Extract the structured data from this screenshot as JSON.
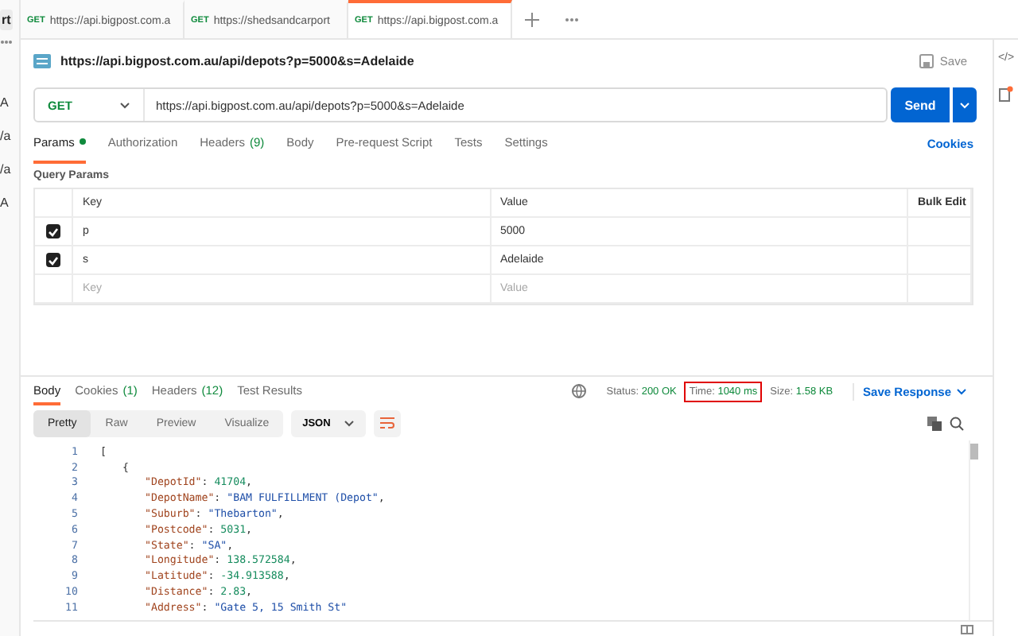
{
  "sidebar": {
    "items": [
      {
        "label": "rt",
        "kind": "button"
      },
      {
        "label": "A",
        "kind": "text"
      },
      {
        "label": "/a",
        "kind": "text"
      },
      {
        "label": "/a",
        "kind": "text"
      },
      {
        "label": "A",
        "kind": "text"
      }
    ]
  },
  "tabs": [
    {
      "method": "GET",
      "url": "https://api.bigpost.com.a",
      "selected": false
    },
    {
      "method": "GET",
      "url": "https://shedsandcarport",
      "selected": false
    },
    {
      "method": "GET",
      "url": "https://api.bigpost.com.a",
      "selected": true
    }
  ],
  "request": {
    "title": "https://api.bigpost.com.au/api/depots?p=5000&s=Adelaide",
    "save": "Save",
    "method": "GET",
    "url": "https://api.bigpost.com.au/api/depots?p=5000&s=Adelaide",
    "send": "Send"
  },
  "request_tabs": [
    {
      "label": "Params",
      "dot": true,
      "selected": true
    },
    {
      "label": "Authorization",
      "dot": false,
      "selected": false
    },
    {
      "label": "Headers",
      "count": "(9)",
      "dot": false,
      "selected": false
    },
    {
      "label": "Body",
      "dot": false,
      "selected": false
    },
    {
      "label": "Pre-request Script",
      "dot": false,
      "selected": false
    },
    {
      "label": "Tests",
      "dot": false,
      "selected": false
    },
    {
      "label": "Settings",
      "dot": false,
      "selected": false
    }
  ],
  "cookies": "Cookies",
  "query_params": {
    "title": "Query Params",
    "columns": [
      "Key",
      "Value"
    ],
    "bulk_edit": "Bulk Edit",
    "rows": [
      {
        "key": "p",
        "value": "5000",
        "checked": true
      },
      {
        "key": "s",
        "value": "Adelaide",
        "checked": true
      }
    ],
    "new_row": {
      "key": {
        "placeholder": "Key"
      },
      "value": {
        "placeholder": "Value"
      }
    }
  },
  "response": {
    "tabs": [
      {
        "label": "Body",
        "selected": true
      },
      {
        "label": "Cookies",
        "count": "(1)",
        "selected": false
      },
      {
        "label": "Headers",
        "count": "(12)",
        "selected": false
      },
      {
        "label": "Test Results",
        "selected": false
      }
    ],
    "stats": [
      {
        "label": "Status:",
        "value": "200 OK",
        "highlighted": false
      },
      {
        "label": "Time:",
        "value": "1040 ms",
        "highlighted": true
      },
      {
        "label": "Size:",
        "value": "1.58 KB",
        "highlighted": false
      }
    ],
    "save_response": "Save Response",
    "views": [
      {
        "label": "Pretty",
        "selected": true
      },
      {
        "label": "Raw",
        "selected": false
      },
      {
        "label": "Preview",
        "selected": false
      },
      {
        "label": "Visualize",
        "selected": false
      }
    ],
    "format": "JSON",
    "code": [
      {
        "number": "1",
        "tokens": [
          {
            "kind": "punct",
            "text": "["
          }
        ],
        "children": [
          {
            "number": "2",
            "tokens": [
              {
                "kind": "punct",
                "text": "{"
              }
            ],
            "children": [
              {
                "number": "3",
                "tokens": [
                  {
                    "kind": "key",
                    "text": "\"DepotId\""
                  },
                  {
                    "kind": "punct",
                    "text": ": "
                  },
                  {
                    "kind": "number",
                    "text": "41704"
                  },
                  {
                    "kind": "punct",
                    "text": ","
                  }
                ]
              },
              {
                "number": "4",
                "tokens": [
                  {
                    "kind": "key",
                    "text": "\"DepotName\""
                  },
                  {
                    "kind": "punct",
                    "text": ": "
                  },
                  {
                    "kind": "string",
                    "text": "\"BAM FULFILLMENT (Depot\""
                  },
                  {
                    "kind": "punct",
                    "text": ","
                  }
                ]
              },
              {
                "number": "5",
                "tokens": [
                  {
                    "kind": "key",
                    "text": "\"Suburb\""
                  },
                  {
                    "kind": "punct",
                    "text": ": "
                  },
                  {
                    "kind": "string",
                    "text": "\"Thebarton\""
                  },
                  {
                    "kind": "punct",
                    "text": ","
                  }
                ]
              },
              {
                "number": "6",
                "tokens": [
                  {
                    "kind": "key",
                    "text": "\"Postcode\""
                  },
                  {
                    "kind": "punct",
                    "text": ": "
                  },
                  {
                    "kind": "number",
                    "text": "5031"
                  },
                  {
                    "kind": "punct",
                    "text": ","
                  }
                ]
              },
              {
                "number": "7",
                "tokens": [
                  {
                    "kind": "key",
                    "text": "\"State\""
                  },
                  {
                    "kind": "punct",
                    "text": ": "
                  },
                  {
                    "kind": "string",
                    "text": "\"SA\""
                  },
                  {
                    "kind": "punct",
                    "text": ","
                  }
                ]
              },
              {
                "number": "8",
                "tokens": [
                  {
                    "kind": "key",
                    "text": "\"Longitude\""
                  },
                  {
                    "kind": "punct",
                    "text": ": "
                  },
                  {
                    "kind": "number",
                    "text": "138.572584"
                  },
                  {
                    "kind": "punct",
                    "text": ","
                  }
                ]
              },
              {
                "number": "9",
                "tokens": [
                  {
                    "kind": "key",
                    "text": "\"Latitude\""
                  },
                  {
                    "kind": "punct",
                    "text": ": "
                  },
                  {
                    "kind": "number",
                    "text": "-34.913588"
                  },
                  {
                    "kind": "punct",
                    "text": ","
                  }
                ]
              },
              {
                "number": "10",
                "tokens": [
                  {
                    "kind": "key",
                    "text": "\"Distance\""
                  },
                  {
                    "kind": "punct",
                    "text": ": "
                  },
                  {
                    "kind": "number",
                    "text": "2.83"
                  },
                  {
                    "kind": "punct",
                    "text": ","
                  }
                ]
              },
              {
                "number": "11",
                "tokens": [
                  {
                    "kind": "key",
                    "text": "\"Address\""
                  },
                  {
                    "kind": "punct",
                    "text": ": "
                  },
                  {
                    "kind": "string",
                    "text": "\"Gate 5, 15 Smith St\""
                  }
                ]
              }
            ]
          }
        ]
      }
    ]
  },
  "right_panel": {
    "code_label": "</>"
  }
}
